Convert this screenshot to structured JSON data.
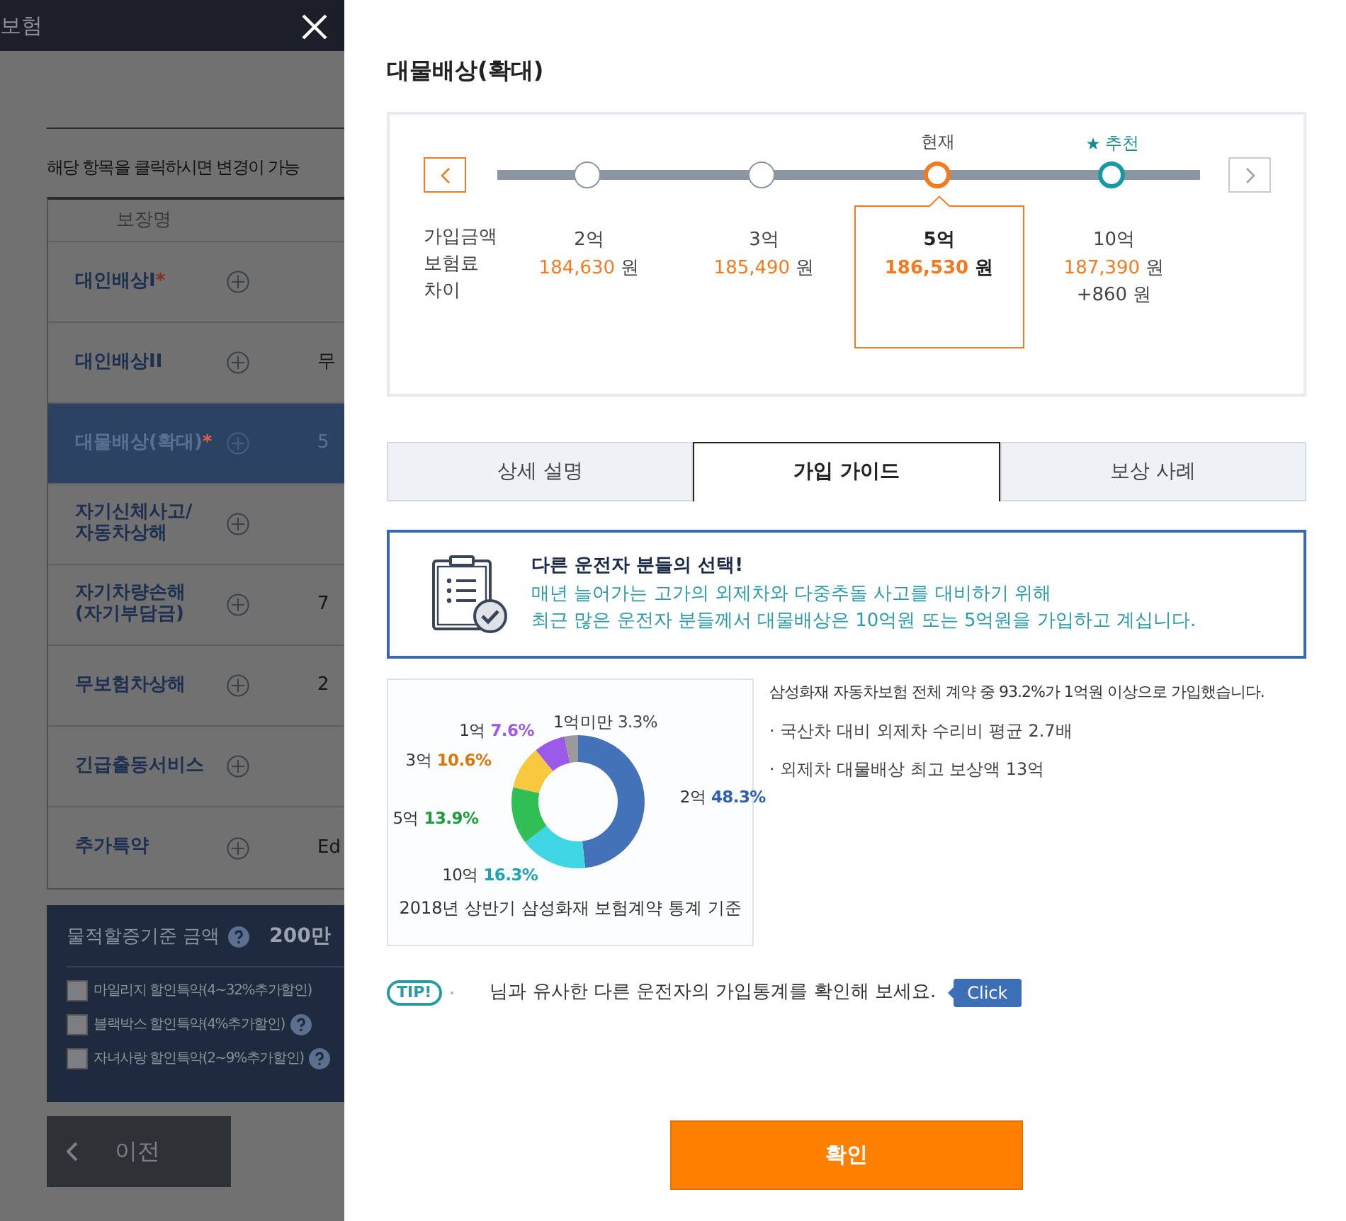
{
  "background_page": {
    "header_title": "보험",
    "notice": "해당 항목을 클릭하시면 변경이 가능",
    "table": {
      "columns": [
        "보장명"
      ],
      "rows": [
        {
          "name": "대인배상I",
          "mark": "*",
          "selected": false
        },
        {
          "name": "대인배상II",
          "selected": false,
          "value": "무"
        },
        {
          "name": "대물배상(확대)",
          "mark": "*",
          "selected": true,
          "value": "5"
        },
        {
          "name": "자기신체사고/\n자동차상해",
          "selected": false
        },
        {
          "name": "자기차량손해\n(자기부담금)",
          "selected": false,
          "value": "7"
        },
        {
          "name": "무보험차상해",
          "selected": false,
          "value": "2"
        },
        {
          "name": "긴급출동서비스",
          "selected": false
        },
        {
          "name": "추가특약",
          "selected": false,
          "value": "Ed"
        }
      ]
    },
    "surcharge": {
      "label": "물적할증기준 금액",
      "value": "200만"
    },
    "discounts": [
      {
        "label": "마일리지 할인특약(4~32%추가할인)",
        "checked": false,
        "help": false
      },
      {
        "label": "블랙박스 할인특약(4%추가할인)",
        "checked": false,
        "help": true
      },
      {
        "label": "자녀사랑 할인특약(2~9%추가할인)",
        "checked": false,
        "help": true
      }
    ],
    "prev_button": "이전"
  },
  "panel": {
    "title": "대물배상(확대)",
    "slider": {
      "row_labels": [
        "가입금액",
        "보험료",
        "차이"
      ],
      "steps": [
        {
          "amount": "2억",
          "premium": "184,630",
          "unit": "원",
          "selected": false,
          "recommended": false
        },
        {
          "amount": "3억",
          "premium": "185,490",
          "unit": "원",
          "selected": false,
          "recommended": false
        },
        {
          "amount": "5억",
          "premium": "186,530",
          "unit": "원",
          "selected": true,
          "recommended": false,
          "tag": "현재"
        },
        {
          "amount": "10억",
          "premium": "187,390",
          "unit": "원",
          "diff": "+860 원",
          "selected": false,
          "recommended": true,
          "tag": "추천"
        }
      ]
    },
    "tabs": [
      {
        "label": "상세 설명",
        "selected": false
      },
      {
        "label": "가입 가이드",
        "selected": true
      },
      {
        "label": "보상 사례",
        "selected": false
      }
    ],
    "guide": {
      "title": "다른 운전자 분들의 선택!",
      "lines": [
        "매년 늘어가는 고가의 외제차와 다중추돌 사고를 대비하기 위해",
        "최근 많은 운전자 분들께서 대물배상은 10억원 또는 5억원을 가입하고 계십니다."
      ]
    },
    "chart": {
      "chart_data": {
        "type": "donut",
        "categories": [
          "2억",
          "10억",
          "5억",
          "3억",
          "1억",
          "1억미만"
        ],
        "values": [
          48.3,
          16.3,
          13.9,
          10.6,
          7.6,
          3.3
        ],
        "colors": [
          "#4472b8",
          "#3fd5e2",
          "#2fbf55",
          "#f8c93f",
          "#9b59e8",
          "#9a9a9a"
        ],
        "value_labels": [
          "48.3%",
          "16.3%",
          "13.9%",
          "10.6%",
          "7.6%",
          "3.3%"
        ]
      },
      "caption": "2018년 상반기 삼성화재 보험계약 통계 기준"
    },
    "stats": {
      "headline": "삼성화재 자동차보험 전체 계약 중 93.2%가 1억원 이상으로 가입했습니다.",
      "bullets": [
        "· 국산차 대비 외제차 수리비 평균 2.7배",
        "· 외제차 대물배상 최고 보상액 13억"
      ]
    },
    "tip": {
      "badge": "TIP!",
      "text": "님과 유사한 다른 운전자의 가입통계를 확인해 보세요.",
      "button": "Click"
    },
    "confirm_button": "확인"
  }
}
